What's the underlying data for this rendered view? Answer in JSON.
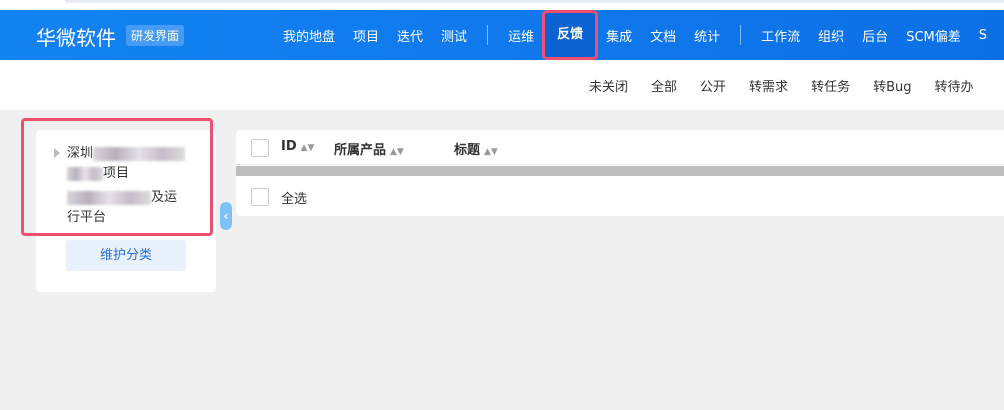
{
  "header": {
    "logo": "华微软件",
    "badge": "研发界面",
    "nav": [
      "我的地盘",
      "项目",
      "迭代",
      "测试",
      "运维",
      "反馈",
      "集成",
      "文档",
      "统计",
      "工作流",
      "组织",
      "后台",
      "SCM偏差",
      "S"
    ],
    "active": "反馈"
  },
  "subnav": [
    "未关闭",
    "全部",
    "公开",
    "转需求",
    "转任务",
    "转Bug",
    "转待办"
  ],
  "sidebar": {
    "tree": [
      {
        "prefix": "深圳",
        "suffix": "项目"
      },
      {
        "suffix": "及运",
        "line2": "行平台"
      }
    ],
    "maintain_label": "维护分类"
  },
  "table": {
    "columns": [
      "ID",
      "所属产品",
      "标题"
    ],
    "select_all": "全选"
  }
}
